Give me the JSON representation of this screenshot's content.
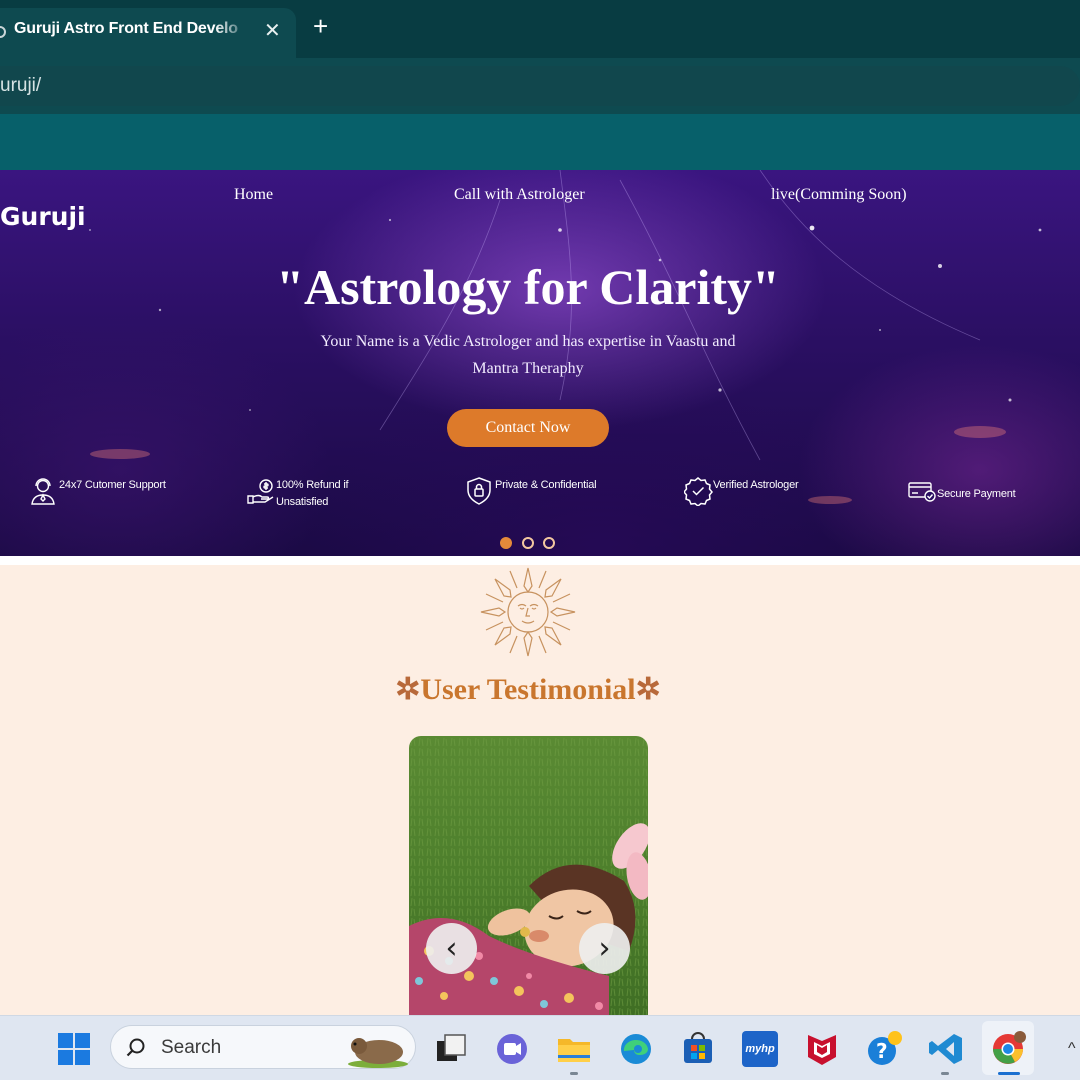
{
  "browser": {
    "tab_title": "Guruji Astro   Front End Develo",
    "close_glyph": "✕",
    "new_tab_glyph": "+",
    "address": "uruji/"
  },
  "hero": {
    "brand": "Guruji",
    "nav": [
      "Home",
      "Call with Astrologer",
      "live(Comming Soon)"
    ],
    "headline": "\"Astrology for Clarity\"",
    "subtitle": "Your Name is a Vedic Astrologer and has expertise in Vaastu and Mantra Theraphy",
    "cta": "Contact Now",
    "features": [
      {
        "label": "24x7 Cutomer Support",
        "icon": "support-agent-icon"
      },
      {
        "label": "100% Refund if Unsatisfied",
        "icon": "refund-hand-icon"
      },
      {
        "label": "Private & Confidential",
        "icon": "shield-lock-icon"
      },
      {
        "label": "Verified Astrologer",
        "icon": "verified-badge-icon"
      },
      {
        "label": "Secure Payment",
        "icon": "card-check-icon"
      }
    ],
    "slides": 3,
    "active_slide": 1
  },
  "testimonial": {
    "title": "User Testimonial",
    "title_glyph": "✲",
    "prev_glyph": "‹",
    "next_glyph": "›",
    "icon": "sun-face-icon"
  },
  "taskbar": {
    "search_label": "Search",
    "apps": [
      "start-icon",
      "search-icon",
      "task-view-icon",
      "teams-icon",
      "file-explorer-icon",
      "edge-icon",
      "store-icon",
      "myhp-icon",
      "mcafee-icon",
      "help-icon",
      "vscode-icon",
      "chrome-icon"
    ],
    "myhp_text": "myhp"
  },
  "colors": {
    "tab_bar": "#083c42",
    "accent_orange": "#dd7a2a",
    "section_bg": "#fdeee3",
    "title_orange": "#c9762e"
  }
}
